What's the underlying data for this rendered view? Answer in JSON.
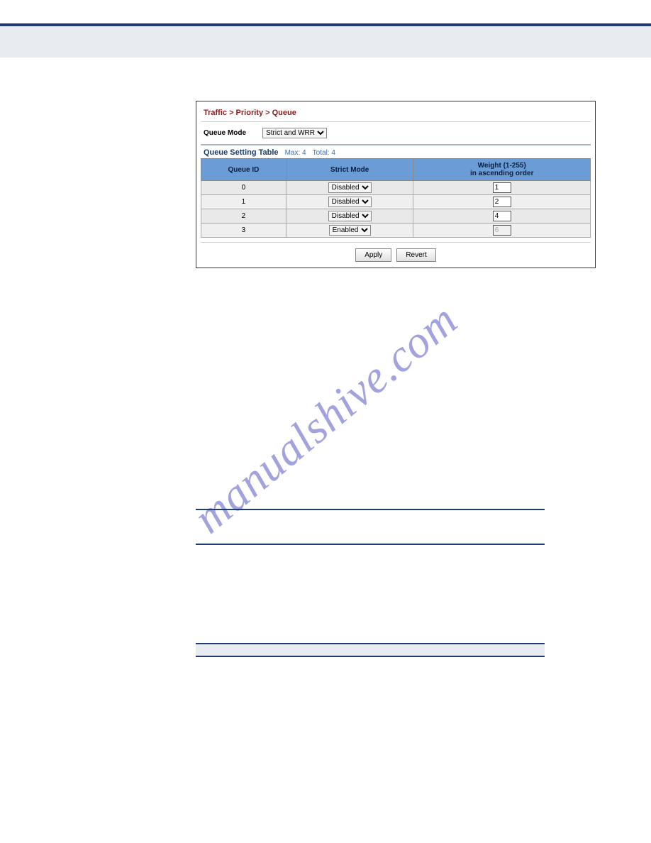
{
  "watermark": "manualshive.com",
  "breadcrumb": "Traffic > Priority > Queue",
  "queue_mode": {
    "label": "Queue Mode",
    "selected": "Strict and WRR"
  },
  "table": {
    "name": "Queue Setting Table",
    "max_label": "Max: 4",
    "total_label": "Total: 4",
    "headers": {
      "id": "Queue ID",
      "mode": "Strict Mode",
      "weight": "Weight (1-255)\nin ascending order"
    },
    "rows": [
      {
        "id": "0",
        "mode": "Disabled",
        "weight": "1",
        "weight_disabled": false
      },
      {
        "id": "1",
        "mode": "Disabled",
        "weight": "2",
        "weight_disabled": false
      },
      {
        "id": "2",
        "mode": "Disabled",
        "weight": "4",
        "weight_disabled": false
      },
      {
        "id": "3",
        "mode": "Enabled",
        "weight": "6",
        "weight_disabled": true
      }
    ]
  },
  "buttons": {
    "apply": "Apply",
    "revert": "Revert"
  }
}
